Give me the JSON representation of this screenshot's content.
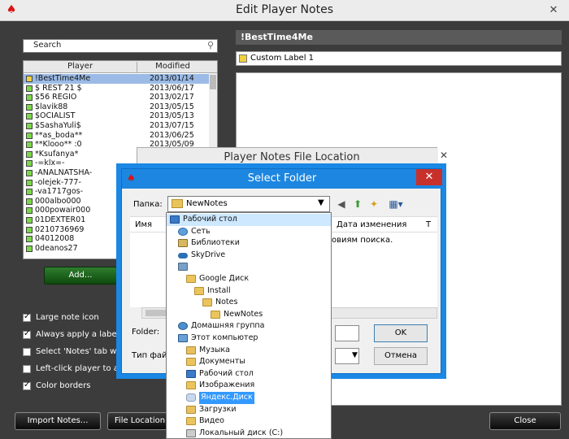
{
  "main": {
    "title": "Edit Player Notes",
    "close": "✕",
    "search": {
      "placeholder": "Search"
    },
    "list": {
      "col_player": "Player",
      "col_modified": "Modified",
      "rows": [
        {
          "name": "!BestTime4Me",
          "date": "2013/01/14",
          "color": "#f0d040",
          "selected": true
        },
        {
          "name": "$ REST 21 $",
          "date": "2013/06/17",
          "color": "#7cd84a"
        },
        {
          "name": "$56 REGIO",
          "date": "2013/02/17",
          "color": "#7cd84a"
        },
        {
          "name": "$lavik88",
          "date": "2013/05/15",
          "color": "#7cd84a"
        },
        {
          "name": "$OCIALIST",
          "date": "2013/05/13",
          "color": "#7cd84a"
        },
        {
          "name": "$SashaYuli$",
          "date": "2013/07/15",
          "color": "#7cd84a"
        },
        {
          "name": "**as_boda**",
          "date": "2013/06/25",
          "color": "#7cd84a"
        },
        {
          "name": "**Klooo** :0",
          "date": "2013/05/09",
          "color": "#7cd84a"
        },
        {
          "name": "*Ksufanya*",
          "date": "",
          "color": "#7cd84a"
        },
        {
          "name": "-=klx=-",
          "date": "",
          "color": "#7cd84a"
        },
        {
          "name": "-ANALNATSHA-",
          "date": "",
          "color": "#7cd84a"
        },
        {
          "name": "-olejek-777-",
          "date": "",
          "color": "#7cd84a"
        },
        {
          "name": "-va1717gos-",
          "date": "",
          "color": "#7cd84a"
        },
        {
          "name": "000albo000",
          "date": "",
          "color": "#7cd84a"
        },
        {
          "name": "000powair000",
          "date": "",
          "color": "#7cd84a"
        },
        {
          "name": "01DEXTER01",
          "date": "",
          "color": "#7cd84a"
        },
        {
          "name": "0210736969",
          "date": "",
          "color": "#7cd84a"
        },
        {
          "name": "04012008",
          "date": "",
          "color": "#7cd84a"
        },
        {
          "name": "0deanos27",
          "date": "",
          "color": "#7cd84a"
        }
      ]
    },
    "add_button": "Add...",
    "options": [
      {
        "label": "Large note icon",
        "checked": true
      },
      {
        "label": "Always apply a label o",
        "checked": true
      },
      {
        "label": "Select 'Notes' tab whe",
        "checked": false
      },
      {
        "label": "Left-click player to assi",
        "checked": false
      },
      {
        "label": "Color borders",
        "checked": true
      }
    ],
    "import_button": "Import Notes...",
    "file_location_button": "File Location",
    "close_button": "Close",
    "notes_title": "!BestTime4Me",
    "label": "Custom Label 1"
  },
  "file_location_dialog": {
    "title": "Player Notes File Location",
    "close": "✕"
  },
  "select_folder": {
    "title": "Select Folder",
    "close": "✕",
    "folder_label": "Папка:",
    "folder_value": "NewNotes",
    "col_name": "Имя",
    "col_date": "Дата изменения",
    "col_type": "Т",
    "empty_message": "овиям поиска.",
    "folder_field_label": "Folder:",
    "file_type_label": "Тип файл",
    "ok": "OK",
    "cancel": "Отмена"
  },
  "tree": [
    {
      "label": "Рабочий стол",
      "indent": 0,
      "icon": "desk",
      "selected": true
    },
    {
      "label": "Сеть",
      "indent": 1,
      "icon": "net"
    },
    {
      "label": "Библиотеки",
      "indent": 1,
      "icon": "lib"
    },
    {
      "label": "SkyDrive",
      "indent": 1,
      "icon": "cloud"
    },
    {
      "label": "",
      "indent": 1,
      "icon": "user"
    },
    {
      "label": "Google Диск",
      "indent": 2,
      "icon": "folder"
    },
    {
      "label": "Install",
      "indent": 3,
      "icon": "folder"
    },
    {
      "label": "Notes",
      "indent": 4,
      "icon": "folder"
    },
    {
      "label": "NewNotes",
      "indent": 5,
      "icon": "folder"
    },
    {
      "label": "Домашняя группа",
      "indent": 1,
      "icon": "group"
    },
    {
      "label": "Этот компьютер",
      "indent": 1,
      "icon": "pc"
    },
    {
      "label": "Музыка",
      "indent": 2,
      "icon": "music"
    },
    {
      "label": "Документы",
      "indent": 2,
      "icon": "folder"
    },
    {
      "label": "Рабочий стол",
      "indent": 2,
      "icon": "desk"
    },
    {
      "label": "Изображения",
      "indent": 2,
      "icon": "folder"
    },
    {
      "label": "Яндекс.Диск",
      "indent": 2,
      "icon": "yd",
      "highlighted": true
    },
    {
      "label": "Загрузки",
      "indent": 2,
      "icon": "dl"
    },
    {
      "label": "Видео",
      "indent": 2,
      "icon": "folder"
    },
    {
      "label": "Локальный диск (C:)",
      "indent": 2,
      "icon": "disk"
    }
  ]
}
